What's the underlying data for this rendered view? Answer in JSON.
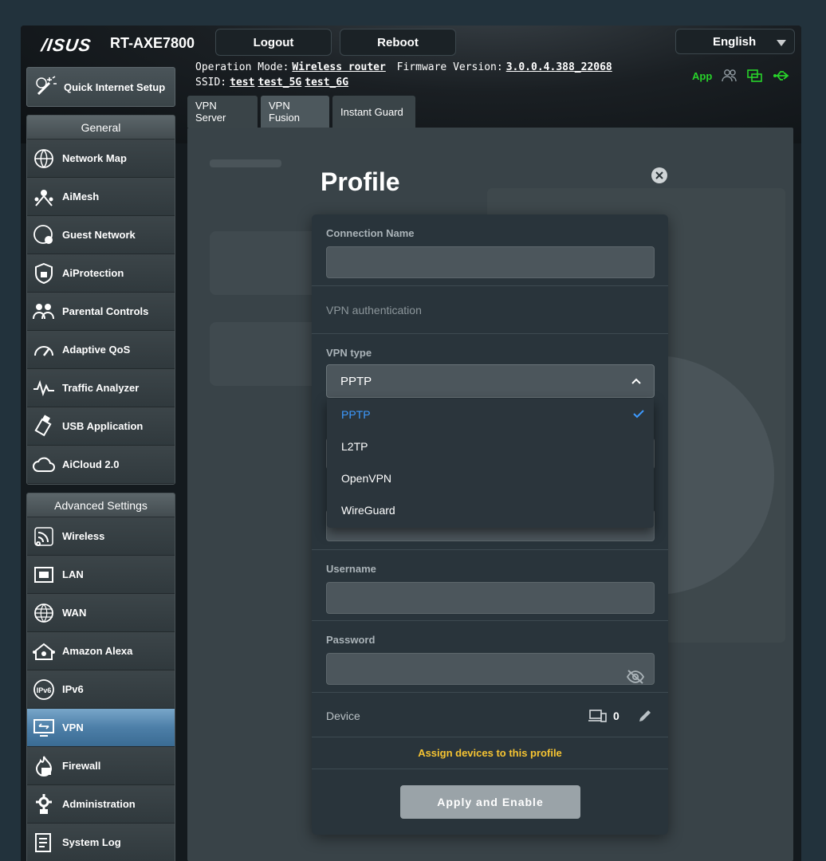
{
  "header": {
    "brand": "/ISUS",
    "model": "RT-AXE7800",
    "logout_label": "Logout",
    "reboot_label": "Reboot",
    "language": "English",
    "operation_mode_label": "Operation Mode:",
    "operation_mode_value": "Wireless router",
    "firmware_label": "Firmware Version:",
    "firmware_value": "3.0.0.4.388_22068",
    "ssid_label": "SSID:",
    "ssids": [
      "test",
      "test_5G",
      "test_6G"
    ],
    "app_label": "App"
  },
  "sidebar": {
    "quick_setup": "Quick Internet Setup",
    "general_title": "General",
    "general_items": [
      {
        "label": "Network Map",
        "icon": "network-map-icon"
      },
      {
        "label": "AiMesh",
        "icon": "aimesh-icon"
      },
      {
        "label": "Guest Network",
        "icon": "guest-network-icon"
      },
      {
        "label": "AiProtection",
        "icon": "aiprotection-icon"
      },
      {
        "label": "Parental Controls",
        "icon": "parental-controls-icon"
      },
      {
        "label": "Adaptive QoS",
        "icon": "qos-icon"
      },
      {
        "label": "Traffic Analyzer",
        "icon": "traffic-analyzer-icon"
      },
      {
        "label": "USB Application",
        "icon": "usb-icon"
      },
      {
        "label": "AiCloud 2.0",
        "icon": "aicloud-icon"
      }
    ],
    "advanced_title": "Advanced Settings",
    "advanced_items": [
      {
        "label": "Wireless",
        "icon": "wireless-icon"
      },
      {
        "label": "LAN",
        "icon": "lan-icon"
      },
      {
        "label": "WAN",
        "icon": "wan-icon"
      },
      {
        "label": "Amazon Alexa",
        "icon": "alexa-icon"
      },
      {
        "label": "IPv6",
        "icon": "ipv6-icon"
      },
      {
        "label": "VPN",
        "icon": "vpn-icon",
        "active": true
      },
      {
        "label": "Firewall",
        "icon": "firewall-icon"
      },
      {
        "label": "Administration",
        "icon": "administration-icon"
      },
      {
        "label": "System Log",
        "icon": "system-log-icon"
      }
    ]
  },
  "tabs": [
    "VPN Server",
    "VPN Fusion",
    "Instant Guard"
  ],
  "active_tab": "VPN Fusion",
  "modal": {
    "title": "Profile",
    "connection_name_label": "Connection Name",
    "connection_name_value": "",
    "vpn_auth_label": "VPN authentication",
    "vpn_type_label": "VPN type",
    "vpn_type_selected": "PPTP",
    "vpn_type_options": [
      "PPTP",
      "L2TP",
      "OpenVPN",
      "WireGuard"
    ],
    "username_label": "Username",
    "username_value": "",
    "password_label": "Password",
    "password_value": "",
    "device_label": "Device",
    "device_count": "0",
    "assign_label": "Assign devices to this profile",
    "apply_label": "Apply and Enable"
  },
  "colors": {
    "accent_blue": "#3d9aff",
    "assign_yellow": "#f6c432",
    "status_green": "#28d22a",
    "active_menu": "#4d7fa8"
  }
}
